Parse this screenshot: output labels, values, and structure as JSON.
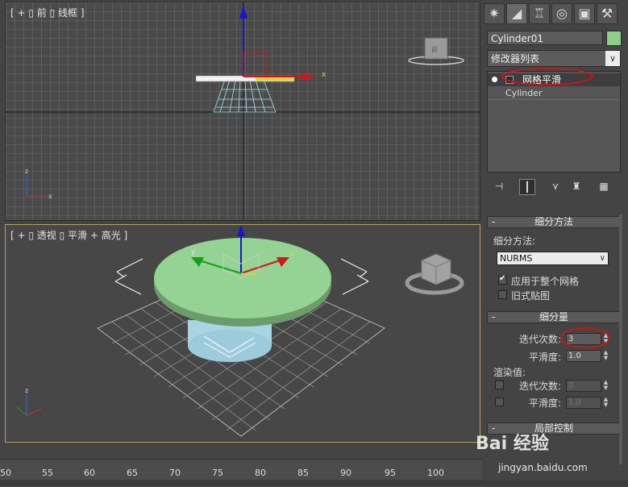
{
  "viewport_top": {
    "label": "[ + ▯ 前 ▯ 线框 ]"
  },
  "viewport_bottom": {
    "label": "[ + ▯ 透视 ▯ 平滑 + 高光 ]"
  },
  "panel": {
    "object_name": "Cylinder01",
    "object_color": "#8bd08b",
    "modifier_list": "修改器列表",
    "stack": [
      {
        "label": "网格平滑",
        "selected": true
      },
      {
        "label": "Cylinder",
        "selected": false
      }
    ],
    "tabs": [
      "create-icon",
      "modify-icon",
      "hierarchy-icon",
      "motion-icon",
      "display-icon",
      "utilities-icon"
    ],
    "toolbar_icons": [
      "pin-stack-icon",
      "show-end-result-icon",
      "make-unique-icon",
      "remove-modifier-icon",
      "configure-sets-icon"
    ]
  },
  "rollout_subdivision_method": {
    "title": "细分方法",
    "method_label": "细分方法:",
    "method_value": "NURMS",
    "apply_whole_mesh": "应用于整个网格",
    "apply_whole_mesh_checked": true,
    "old_style_mapping": "旧式贴图",
    "old_style_mapping_checked": false
  },
  "rollout_subdivision_amount": {
    "title": "细分量",
    "iterations_label": "迭代次数:",
    "iterations_value": "3",
    "smoothness_label": "平滑度:",
    "smoothness_value": "1.0",
    "render_values_label": "渲染值:",
    "render_iterations_label": "迭代次数:",
    "render_iterations_value": "0",
    "render_smoothness_label": "平滑度:",
    "render_smoothness_value": "1.0"
  },
  "rollout_local_control": {
    "title": "局部控制"
  },
  "timeline": {
    "ticks": [
      "50",
      "55",
      "60",
      "65",
      "70",
      "75",
      "80",
      "85",
      "90",
      "95",
      "100"
    ]
  },
  "watermark": {
    "brand": "Bai 经验",
    "url": "jingyan.baidu.com"
  }
}
